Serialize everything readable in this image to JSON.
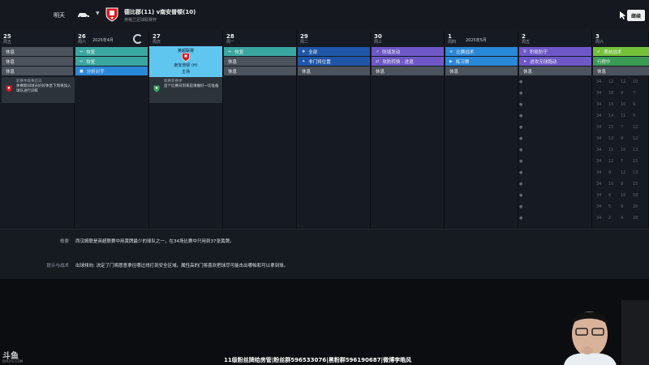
{
  "topbar": {
    "tomorrow_label": "明天",
    "match_title": "德比郡(11) v南安普顿(10)",
    "match_subtitle": "英格兰足球联赛杯",
    "continue_label": "继续"
  },
  "calendar": {
    "month_apr": "2025年4月",
    "month_may": "2025年5月",
    "days": [
      {
        "num": "25",
        "weekday": "周五"
      },
      {
        "num": "26",
        "weekday": "周六"
      },
      {
        "num": "27",
        "weekday": "周日"
      },
      {
        "num": "28",
        "weekday": "周一"
      },
      {
        "num": "29",
        "weekday": "周二"
      },
      {
        "num": "30",
        "weekday": "周三"
      },
      {
        "num": "1",
        "weekday": "周四"
      },
      {
        "num": "2",
        "weekday": "周五"
      },
      {
        "num": "3",
        "weekday": "周六"
      }
    ],
    "sessions": {
      "d25": [
        "休息",
        "休息",
        "休息"
      ],
      "d26": [
        "恢复",
        "恢复",
        "分析对手"
      ],
      "d28": [
        "恢复",
        "休息",
        "休息"
      ],
      "d29": [
        "全部",
        "非门将位置",
        "休息"
      ],
      "d30": [
        "防填发动",
        "攻防转换 - 进退",
        "休息"
      ],
      "d1": [
        "比赛战术",
        "练习赛",
        "休息"
      ],
      "d2": [
        "积极防守",
        "进攻无球跑动",
        "休息"
      ],
      "d3": [
        "赛前战术",
        "行程中",
        "休息"
      ]
    },
    "match_card": {
      "competition": "英超联赛",
      "opponent": "南安普顿 (H)",
      "venue": "主场"
    },
    "notes": [
      {
        "title": "新赛季联赛首日",
        "body": "休赛期间球员好好休息下周将加入球队进行训练"
      },
      {
        "title": "联赛新赛季",
        "body": "首个比赛日到来前请做好一切准备"
      }
    ]
  },
  "description": {
    "summary_label": "概要",
    "summary_text": "西汉姆联是英超联赛中用黄牌最少的球队之一，在34场比赛中只用到37张黄牌。",
    "tactics_label": "提示与战术",
    "tactics_text": "出球倾向: 决定了门将愿意拿往哪过线打到安全区域。属性高的门将喜欢把球尽可能击出哪帕和可以拿到球。"
  },
  "stream": {
    "watermark": "斗鱼",
    "watermark_sub": "DOUYU.COM",
    "ticker": "11级粉丝牌给房管|粉丝群596533076|黑粉群596190687|微博李皓风"
  },
  "colors": {
    "recovery": "#3aa6a0",
    "tactic": "#2a88d8",
    "position": "#1f56a8",
    "transition": "#6e58c8",
    "defense": "#74c23a",
    "rest": "#4d535c",
    "match": "#5fc6f0"
  }
}
